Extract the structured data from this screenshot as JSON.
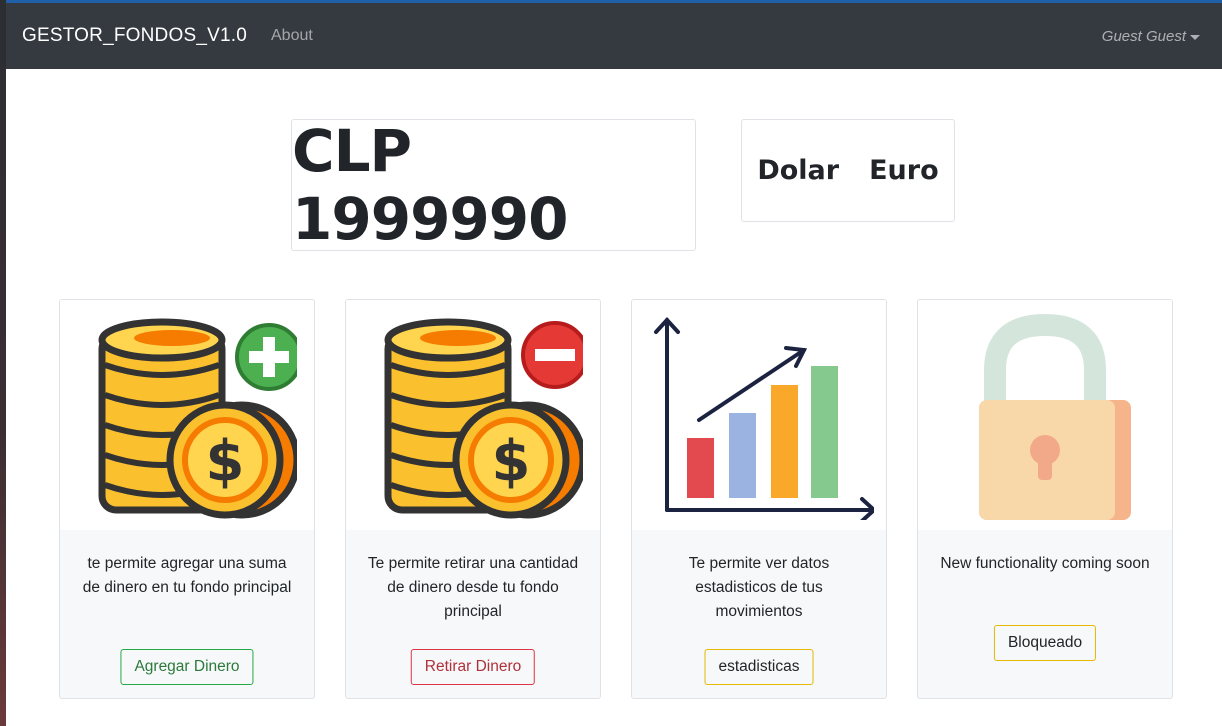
{
  "navbar": {
    "brand": "GESTOR_FONDOS_V1.0",
    "about_label": "About",
    "user_label": "Guest Guest"
  },
  "balance": {
    "text": "CLP 1999990"
  },
  "currencies": [
    "Dolar",
    "Euro"
  ],
  "cards": [
    {
      "icon": "coins-plus-icon",
      "text": "te permite agregar una suma de dinero en tu fondo principal",
      "button": "Agregar Dinero"
    },
    {
      "icon": "coins-minus-icon",
      "text": "Te permite retirar una cantidad de dinero desde tu fondo principal",
      "button": "Retirar Dinero"
    },
    {
      "icon": "bar-chart-icon",
      "text": "Te permite ver datos estadisticos de tus movimientos",
      "button": "estadisticas"
    },
    {
      "icon": "lock-icon",
      "text": "New functionality coming soon",
      "button": "Bloqueado"
    }
  ],
  "colors": {
    "navbar_bg": "#343a40",
    "success": "#28a745",
    "danger": "#dc3545",
    "warning": "#ffc107"
  }
}
